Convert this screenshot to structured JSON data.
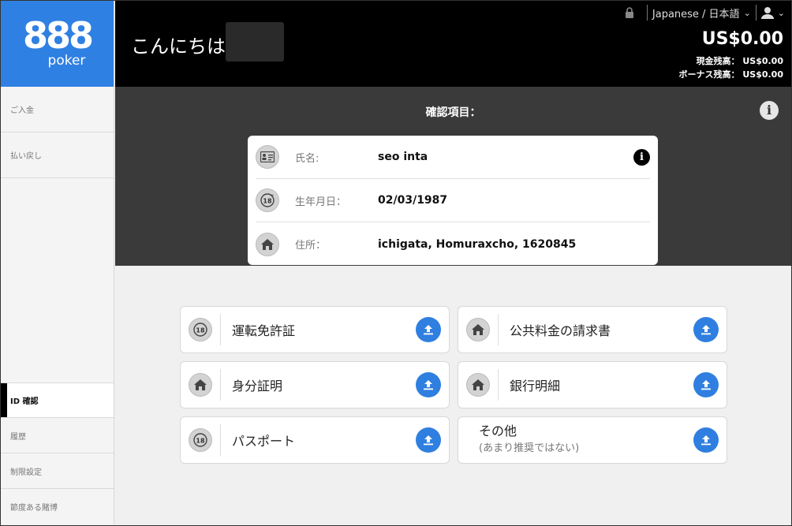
{
  "logo": {
    "number": "888",
    "word": "poker"
  },
  "sidebar": {
    "top_items": [
      {
        "label": "ご入金"
      },
      {
        "label": "払い戻し"
      }
    ],
    "bottom_items": [
      {
        "label": "ID 確認",
        "active": true
      },
      {
        "label": "履歴"
      },
      {
        "label": "制限設定"
      },
      {
        "label": "節度ある賭博"
      }
    ]
  },
  "header": {
    "greeting": "こんにちは",
    "language": "Japanese / 日本語",
    "balance": "US$0.00",
    "cash_label": "現金残高：",
    "cash_value": "US$0.00",
    "bonus_label": "ボーナス残高：",
    "bonus_value": "US$0.00"
  },
  "verify": {
    "title": "確認項目：",
    "rows": [
      {
        "label": "氏名:",
        "value": "seo inta",
        "icon": "id-card-icon"
      },
      {
        "label": "生年月日：",
        "value": "02/03/1987",
        "icon": "age-18-icon"
      },
      {
        "label": "住所：",
        "value": "ichigata, Homuraxcho, 1620845",
        "icon": "home-icon"
      }
    ]
  },
  "uploads": [
    {
      "label": "運転免許証",
      "icon": "age-18-icon"
    },
    {
      "label": "公共料金の請求書",
      "icon": "home-icon"
    },
    {
      "label": "身分証明",
      "icon": "home-icon"
    },
    {
      "label": "銀行明細",
      "icon": "home-icon"
    },
    {
      "label": "パスポート",
      "icon": "age-18-icon"
    },
    {
      "label": "その他",
      "sub": "(あまり推奨ではない)"
    }
  ],
  "colors": {
    "brand": "#2f80e3",
    "upload": "#2f7fe0"
  }
}
